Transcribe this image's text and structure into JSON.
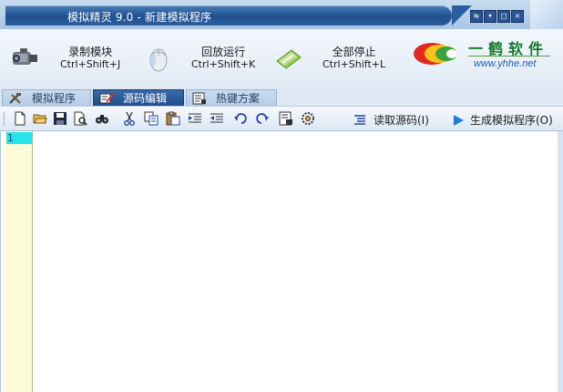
{
  "window": {
    "title": "模拟精灵 9.0 - 新建模拟程序",
    "controls": [
      "restore-icon",
      "minimize-icon",
      "maximize-icon",
      "close-icon"
    ]
  },
  "main_toolbar": {
    "record": {
      "label": "录制模块",
      "shortcut": "Ctrl+Shift+J",
      "icon": "camcorder-icon"
    },
    "playback": {
      "label": "回放运行",
      "shortcut": "Ctrl+Shift+K",
      "icon": "mouse-icon"
    },
    "stop_all": {
      "label": "全部停止",
      "shortcut": "Ctrl+Shift+L",
      "icon": "stop-pen-icon"
    }
  },
  "logo": {
    "name": "一鹤软件",
    "url": "www.yhhe.net"
  },
  "tabs": [
    {
      "label": "模拟程序",
      "active": false,
      "icon": "tools-icon"
    },
    {
      "label": "源码编辑",
      "active": true,
      "icon": "edit-icon"
    },
    {
      "label": "热键方案",
      "active": false,
      "icon": "hotkey-icon"
    }
  ],
  "edit_toolbar": {
    "icons": [
      "new-file-icon",
      "open-folder-icon",
      "save-icon",
      "print-preview-icon",
      "find-icon",
      "cut-icon",
      "copy-icon",
      "paste-icon",
      "indent-icon",
      "outdent-icon",
      "undo-icon",
      "redo-icon",
      "insert-icon",
      "settings-icon"
    ],
    "read_source": "读取源码(I)",
    "generate": "生成模拟程序(O)"
  },
  "editor": {
    "line_numbers": [
      "1"
    ],
    "content": ""
  },
  "colors": {
    "title_blue": "#1f4f8f",
    "active_tab": "#1e4d8c",
    "gutter": "#fbfbd8",
    "current_line": "#27e3ec"
  }
}
